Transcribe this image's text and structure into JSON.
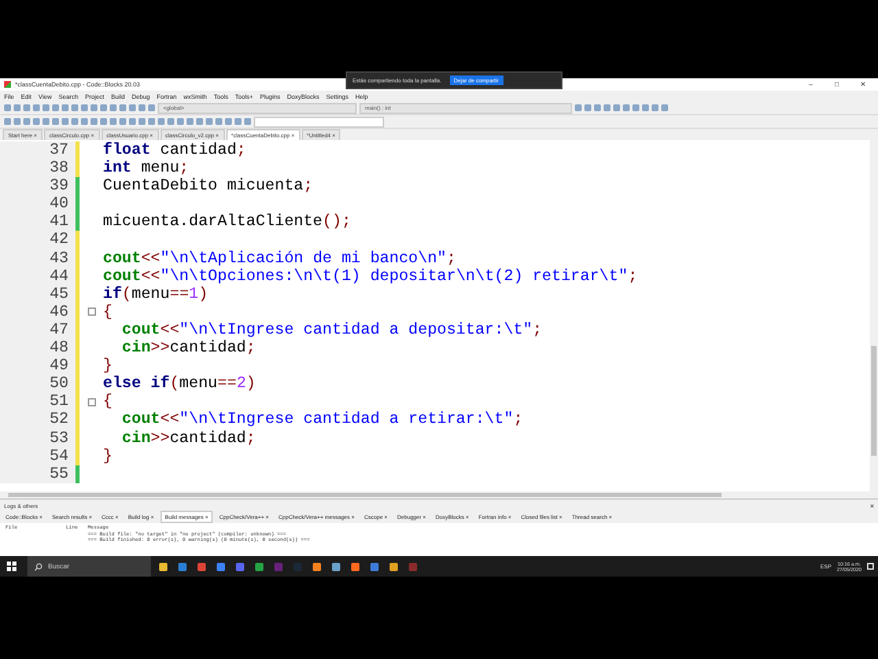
{
  "window": {
    "title": "*classCuentaDebito.cpp - Code::Blocks 20.03",
    "controls": [
      "–",
      "□",
      "✕"
    ]
  },
  "share_bar": {
    "message": "Estás compartiendo toda la pantalla.",
    "button": "Dejar de compartir"
  },
  "menu": [
    "File",
    "Edit",
    "View",
    "Search",
    "Project",
    "Build",
    "Debug",
    "Fortran",
    "wxSmith",
    "Tools",
    "Tools+",
    "Plugins",
    "DoxyBlocks",
    "Settings",
    "Help"
  ],
  "scope_combos": [
    {
      "value": "<global>"
    },
    {
      "value": "main() : int"
    }
  ],
  "editor_tabs": [
    {
      "label": "Start here",
      "close": "×",
      "selected": false
    },
    {
      "label": "classCirculo.cpp",
      "close": "×",
      "selected": false
    },
    {
      "label": "classUsuario.cpp",
      "close": "×",
      "selected": false
    },
    {
      "label": "classCirculo_v2.cpp",
      "close": "×",
      "selected": false
    },
    {
      "label": "*classCuentaDebito.cpp",
      "close": "×",
      "selected": true
    },
    {
      "label": "*Untitled4",
      "close": "×",
      "selected": false
    }
  ],
  "code": [
    {
      "number": "37",
      "color": "#f4e04d",
      "collapsible": false,
      "tokens": [
        {
          "kind": "keyword",
          "text": "float"
        },
        {
          "kind": "plain",
          "text": " cantidad"
        },
        {
          "kind": "operator",
          "text": ";"
        }
      ]
    },
    {
      "number": "38",
      "color": "#f4e04d",
      "collapsible": false,
      "tokens": [
        {
          "kind": "keyword",
          "text": "int"
        },
        {
          "kind": "plain",
          "text": " menu"
        },
        {
          "kind": "operator",
          "text": ";"
        }
      ]
    },
    {
      "number": "39",
      "color": "#3fbf5f",
      "collapsible": false,
      "tokens": [
        {
          "kind": "plain",
          "text": "CuentaDebito micuenta"
        },
        {
          "kind": "operator",
          "text": ";"
        }
      ]
    },
    {
      "number": "40",
      "color": "#3fbf5f",
      "collapsible": false
    },
    {
      "number": "41",
      "color": "#3fbf5f",
      "collapsible": false,
      "tokens": [
        {
          "kind": "plain",
          "text": "micuenta.darAltaCliente"
        },
        {
          "kind": "operator",
          "text": "();"
        }
      ]
    },
    {
      "number": "42",
      "color": "#f4e04d",
      "collapsible": false
    },
    {
      "number": "43",
      "color": "#f4e04d",
      "collapsible": false,
      "tokens": [
        {
          "kind": "stream",
          "text": "cout"
        },
        {
          "kind": "operator",
          "text": "<<"
        },
        {
          "kind": "string",
          "text": "\"\\n\\tAplicación de mi banco\\n\""
        },
        {
          "kind": "operator",
          "text": ";"
        }
      ]
    },
    {
      "number": "44",
      "color": "#f4e04d",
      "collapsible": false,
      "tokens": [
        {
          "kind": "stream",
          "text": "cout"
        },
        {
          "kind": "operator",
          "text": "<<"
        },
        {
          "kind": "string",
          "text": "\"\\n\\tOpciones:\\n\\t(1) depositar\\n\\t(2) retirar\\t\""
        },
        {
          "kind": "operator",
          "text": ";"
        }
      ]
    },
    {
      "number": "45",
      "color": "#f4e04d",
      "collapsible": false,
      "tokens": [
        {
          "kind": "keyword",
          "text": "if"
        },
        {
          "kind": "operator",
          "text": "("
        },
        {
          "kind": "plain",
          "text": "menu"
        },
        {
          "kind": "operator",
          "text": "=="
        },
        {
          "kind": "number",
          "text": "1"
        },
        {
          "kind": "operator",
          "text": ")"
        }
      ]
    },
    {
      "number": "46",
      "color": "#f4e04d",
      "collapsible": true,
      "tokens": [
        {
          "kind": "operator",
          "text": "{"
        }
      ]
    },
    {
      "number": "47",
      "color": "#f4e04d",
      "collapsible": false,
      "tokens": [
        {
          "kind": "stream",
          "text": "  cout"
        },
        {
          "kind": "operator",
          "text": "<<"
        },
        {
          "kind": "string",
          "text": "\"\\n\\tIngrese cantidad a depositar:\\t\""
        },
        {
          "kind": "operator",
          "text": ";"
        }
      ]
    },
    {
      "number": "48",
      "color": "#f4e04d",
      "collapsible": false,
      "tokens": [
        {
          "kind": "stream",
          "text": "  cin"
        },
        {
          "kind": "operator",
          "text": ">>"
        },
        {
          "kind": "plain",
          "text": "cantidad"
        },
        {
          "kind": "operator",
          "text": ";"
        }
      ]
    },
    {
      "number": "49",
      "color": "#f4e04d",
      "collapsible": false,
      "tokens": [
        {
          "kind": "operator",
          "text": "}"
        }
      ]
    },
    {
      "number": "50",
      "color": "#f4e04d",
      "collapsible": false,
      "tokens": [
        {
          "kind": "keyword",
          "text": "else if"
        },
        {
          "kind": "operator",
          "text": "("
        },
        {
          "kind": "plain",
          "text": "menu"
        },
        {
          "kind": "operator",
          "text": "=="
        },
        {
          "kind": "number",
          "text": "2"
        },
        {
          "kind": "operator",
          "text": ")"
        }
      ]
    },
    {
      "number": "51",
      "color": "#f4e04d",
      "collapsible": true,
      "tokens": [
        {
          "kind": "operator",
          "text": "{"
        }
      ]
    },
    {
      "number": "52",
      "color": "#f4e04d",
      "collapsible": false,
      "tokens": [
        {
          "kind": "stream",
          "text": "  cout"
        },
        {
          "kind": "operator",
          "text": "<<"
        },
        {
          "kind": "string",
          "text": "\"\\n\\tIngrese cantidad a retirar:\\t\""
        },
        {
          "kind": "operator",
          "text": ";"
        }
      ]
    },
    {
      "number": "53",
      "color": "#f4e04d",
      "collapsible": false,
      "tokens": [
        {
          "kind": "stream",
          "text": "  cin"
        },
        {
          "kind": "operator",
          "text": ">>"
        },
        {
          "kind": "plain",
          "text": "cantidad"
        },
        {
          "kind": "operator",
          "text": ";"
        }
      ]
    },
    {
      "number": "54",
      "color": "#f4e04d",
      "collapsible": false,
      "tokens": [
        {
          "kind": "operator",
          "text": "}"
        }
      ]
    },
    {
      "number": "55",
      "color": "#3fbf5f",
      "collapsible": false
    }
  ],
  "logs": {
    "title": "Logs & others",
    "close": "✕",
    "tabs": [
      {
        "label": "Code::Blocks",
        "close": "×",
        "selected": false
      },
      {
        "label": "Search results",
        "close": "×",
        "selected": false
      },
      {
        "label": "Cccc",
        "close": "×",
        "selected": false
      },
      {
        "label": "Build log",
        "close": "×",
        "selected": false
      },
      {
        "label": "Build messages",
        "close": "×",
        "selected": true
      },
      {
        "label": "CppCheck/Vera++",
        "close": "×",
        "selected": false
      },
      {
        "label": "CppCheck/Vera++ messages",
        "close": "×",
        "selected": false
      },
      {
        "label": "Cscope",
        "close": "×",
        "selected": false
      },
      {
        "label": "Debugger",
        "close": "×",
        "selected": false
      },
      {
        "label": "DoxyBlocks",
        "close": "×",
        "selected": false
      },
      {
        "label": "Fortran info",
        "close": "×",
        "selected": false
      },
      {
        "label": "Closed files list",
        "close": "×",
        "selected": false
      },
      {
        "label": "Thread search",
        "close": "×",
        "selected": false
      }
    ],
    "columns": [
      "File",
      "Line",
      "Message"
    ],
    "messages": [
      "=== Build file: \"no target\" in \"no project\" (compiler: unknown) ===",
      "=== Build finished: 0 error(s), 0 warning(s) (0 minute(s), 0 second(s)) ==="
    ]
  },
  "taskbar": {
    "search_placeholder": "Buscar",
    "apps": [
      {
        "color": "#e8b931"
      },
      {
        "color": "#2a7fd4"
      },
      {
        "color": "#db4437"
      },
      {
        "color": "#3b82f6"
      },
      {
        "color": "#5865f2"
      },
      {
        "color": "#25a244"
      },
      {
        "color": "#68217a"
      },
      {
        "color": "#1b2838"
      },
      {
        "color": "#f48120"
      },
      {
        "color": "#6aa0c8"
      },
      {
        "color": "#ff6a1f"
      },
      {
        "color": "#3d7bd9"
      },
      {
        "color": "#e0a020"
      },
      {
        "color": "#8a2b2b"
      }
    ],
    "language": "ESP",
    "time": "10:16 a.m.",
    "date": "27/05/2020"
  }
}
